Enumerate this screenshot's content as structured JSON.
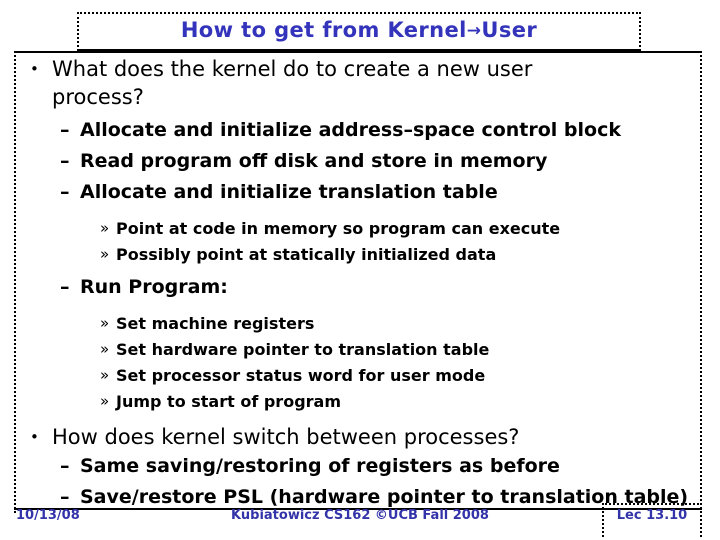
{
  "slide": {
    "title_prefix": "How to get from Kernel",
    "title_arrow": "→",
    "title_suffix": "User",
    "accent_color": "#3333bb",
    "text_color": "#000000",
    "background_color": "#ffffff"
  },
  "bullets": {
    "b1_marker": "•",
    "b1_line1": "What does the kernel do to create a new user",
    "b1_line2": "process?",
    "b2_marker": "–",
    "b2_item1": "Allocate and initialize address–space control block",
    "b2_item2": "Read program off disk and store in memory",
    "b2_item3": "Allocate and initialize translation table",
    "b3_marker": "»",
    "b3_item1": "Point at code in memory so program can execute",
    "b3_item2": "Possibly point at statically initialized data",
    "b2_item4": "Run Program:",
    "b3_item3": "Set machine registers",
    "b3_item4": "Set hardware pointer to translation table",
    "b3_item5": "Set processor status word for user mode",
    "b3_item6": "Jump to start of program",
    "b1_line3": "How does kernel switch between processes?",
    "b2_item5": "Same saving/restoring of registers as before",
    "b2_item6": "Save/restore PSL (hardware pointer to translation table)"
  },
  "footer": {
    "date": "10/13/08",
    "course": "Kubiatowicz CS162 ©UCB Fall 2008",
    "lecture": "Lec 13.10",
    "color": "#3333aa"
  }
}
